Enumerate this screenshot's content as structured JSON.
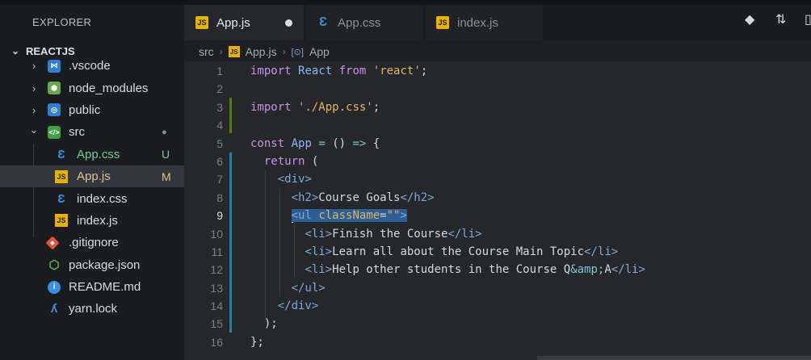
{
  "sidebar": {
    "title": "EXPLORER",
    "root": "REACTJS",
    "items": [
      {
        "label": ".vscode",
        "kind": "folder",
        "icon": "vscode-folder-icon",
        "color": "#3b8fe0",
        "badge": ""
      },
      {
        "label": "node_modules",
        "kind": "folder",
        "icon": "node-folder-icon",
        "color": "#7cb342",
        "badge": ""
      },
      {
        "label": "public",
        "kind": "folder",
        "icon": "public-folder-icon",
        "color": "#3b8fe0",
        "badge": ""
      },
      {
        "label": "src",
        "kind": "folder-open",
        "icon": "src-folder-icon",
        "color": "#4caf50",
        "badge": "●"
      },
      {
        "label": "App.css",
        "kind": "file",
        "icon": "css-file-icon",
        "color": "#8db9e8",
        "badge": "U"
      },
      {
        "label": "App.js",
        "kind": "file",
        "icon": "js-file-icon",
        "color": "#e2c08d",
        "badge": "M"
      },
      {
        "label": "index.css",
        "kind": "file",
        "icon": "css-file-icon",
        "color": "#d8dbe0",
        "badge": ""
      },
      {
        "label": "index.js",
        "kind": "file",
        "icon": "js-file-icon",
        "color": "#d8dbe0",
        "badge": ""
      },
      {
        "label": ".gitignore",
        "kind": "file",
        "icon": "git-file-icon",
        "color": "#d8dbe0",
        "badge": ""
      },
      {
        "label": "package.json",
        "kind": "file",
        "icon": "nodejs-file-icon",
        "color": "#d8dbe0",
        "badge": ""
      },
      {
        "label": "README.md",
        "kind": "file",
        "icon": "info-file-icon",
        "color": "#d8dbe0",
        "badge": ""
      },
      {
        "label": "yarn.lock",
        "kind": "file",
        "icon": "yarn-file-icon",
        "color": "#d8dbe0",
        "badge": ""
      }
    ]
  },
  "tabs": [
    {
      "label": "App.js",
      "icon": "js-file-icon",
      "active": true,
      "modified": true
    },
    {
      "label": "App.css",
      "icon": "css-file-icon",
      "active": false,
      "modified": false
    },
    {
      "label": "index.js",
      "icon": "js-file-icon",
      "active": false,
      "modified": false
    }
  ],
  "toolbar": {
    "git_icon": "git-compare-icon",
    "pr_icon": "pull-request-icon"
  },
  "breadcrumb": {
    "part1": "src",
    "part2": "App.js",
    "part3": "App",
    "js_badge": "JS",
    "symbol_badge": "[⊙]"
  },
  "editor": {
    "current_line": 9,
    "line_numbers": [
      "1",
      "2",
      "3",
      "4",
      "5",
      "6",
      "7",
      "8",
      "9",
      "10",
      "11",
      "12",
      "13",
      "14",
      "15",
      "16"
    ]
  },
  "colors": {
    "accent": "#2f5e93",
    "modified_badge": "#e2c08d",
    "untracked_badge": "#73c991",
    "added_gutter": "#587c0c",
    "modified_gutter": "#1b81a8"
  }
}
